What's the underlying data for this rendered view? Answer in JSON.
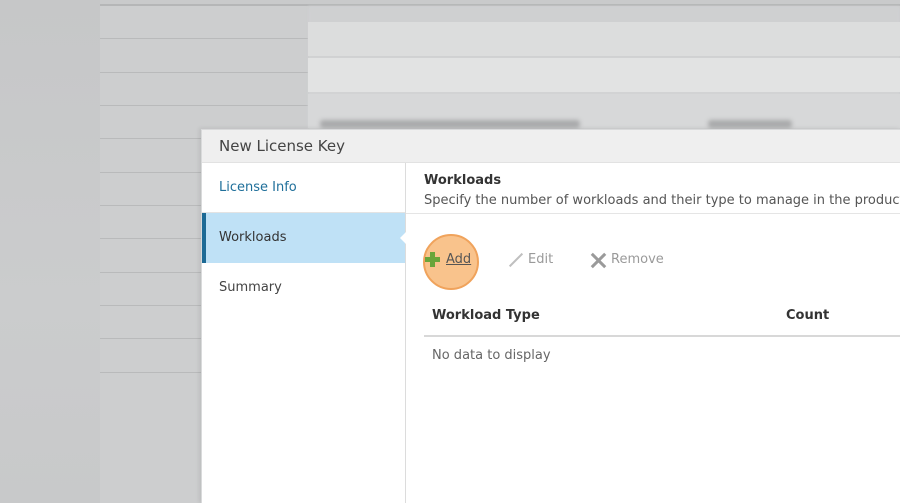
{
  "dialog": {
    "title": "New License Key"
  },
  "nav": {
    "items": [
      {
        "label": "License Info",
        "state": "link"
      },
      {
        "label": "Workloads",
        "state": "active"
      },
      {
        "label": "Summary",
        "state": "normal"
      }
    ]
  },
  "section": {
    "title": "Workloads",
    "description": "Specify the number of workloads and their type to manage in the product."
  },
  "toolbar": {
    "add_label": "Add",
    "edit_label": "Edit",
    "remove_label": "Remove"
  },
  "grid": {
    "columns": [
      "Workload Type",
      "Count"
    ],
    "empty_message": "No data to display"
  },
  "colors": {
    "accent": "#1d6a95",
    "active_bg": "#bfe1f6",
    "highlight": "#f8b878",
    "plus": "#6aa53a"
  },
  "icons": {
    "add": "plus-icon",
    "edit": "pencil-icon",
    "remove": "close-icon"
  }
}
